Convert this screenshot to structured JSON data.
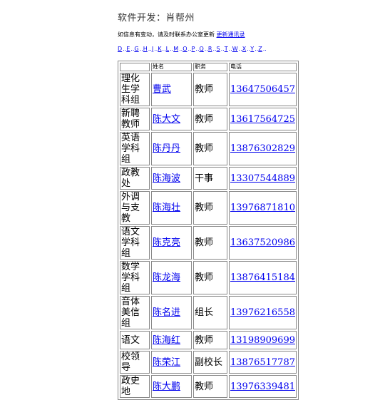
{
  "header": {
    "title": "软件开发：肖帮州"
  },
  "notice": {
    "text": "如信息有变动，请及时联系办公室更新",
    "link": "更新通讯录"
  },
  "letters": [
    "D",
    "E",
    "G",
    "H",
    "J",
    "K",
    "L",
    "M",
    "O",
    "P",
    "Q",
    "R",
    "S",
    "T",
    "W",
    "X",
    "Y",
    "Z"
  ],
  "table": {
    "headers": [
      "",
      "姓名",
      "职务",
      "电话"
    ],
    "rows": [
      {
        "dept": "理化生学科组",
        "name": "曹武",
        "role": "教师",
        "phone": "13647506457"
      },
      {
        "dept": "新聘教师",
        "name": "陈大文",
        "role": "教师",
        "phone": "13617564725"
      },
      {
        "dept": "英语学科组",
        "name": "陈丹丹",
        "role": "教师",
        "phone": "13876302829"
      },
      {
        "dept": "政教处",
        "name": "陈海波",
        "role": "干事",
        "phone": "13307544889"
      },
      {
        "dept": "外调与支教",
        "name": "陈海壮",
        "role": "教师",
        "phone": "13976871810"
      },
      {
        "dept": "语文学科组",
        "name": "陈克亮",
        "role": "教师",
        "phone": "13637520986"
      },
      {
        "dept": "数学学科组",
        "name": "陈龙海",
        "role": "教师",
        "phone": "13876415184"
      },
      {
        "dept": "音体美信组",
        "name": "陈名进",
        "role": "组长",
        "phone": "13976216558"
      },
      {
        "dept": "语文",
        "name": "陈海红",
        "role": "教师",
        "phone": "13198909699"
      },
      {
        "dept": "校领导",
        "name": "陈荣江",
        "role": "副校长",
        "phone": "13876517787"
      },
      {
        "dept": "政史地",
        "name": "陈大鹏",
        "role": "教师",
        "phone": "13976339481"
      }
    ]
  }
}
